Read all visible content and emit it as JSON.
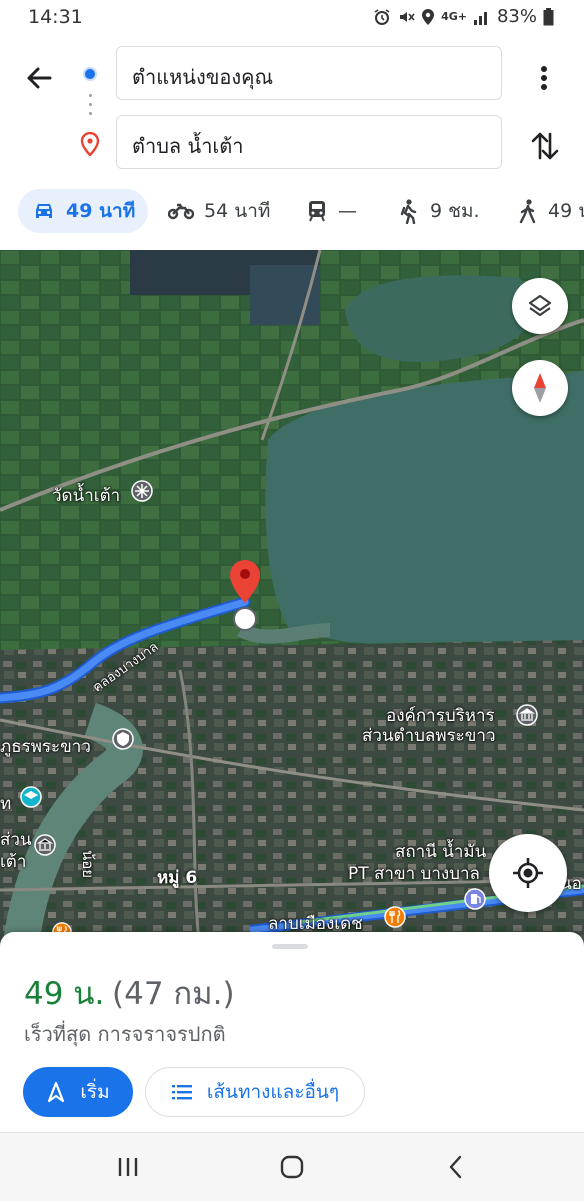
{
  "status_bar": {
    "time": "14:31",
    "network": "4G+",
    "battery": "83%"
  },
  "directions": {
    "origin_value": "ตำแหน่งของคุณ",
    "destination_value": "ตำบล น้ำเต้า"
  },
  "travel_modes": [
    {
      "name": "drive",
      "label": "49 นาที",
      "icon": "car-icon",
      "selected": true
    },
    {
      "name": "motorcycle",
      "label": "54 นาที",
      "icon": "motorcycle-icon"
    },
    {
      "name": "transit",
      "label": "—",
      "icon": "train-icon"
    },
    {
      "name": "walk",
      "label": "9 ชม.",
      "icon": "hiking-icon"
    },
    {
      "name": "hike",
      "label": "49 น",
      "icon": "walking-icon"
    }
  ],
  "map": {
    "labels": {
      "temple": "วัดน้ำเต้า",
      "canal": "คลองบางบาล",
      "canal2": "น้อย",
      "org_line1": "องค์การบริหาร",
      "org_line2": "ส่วนตำบลพระขาว",
      "left_place": "ภูธรพระขาว",
      "left_edge1": "ท",
      "left_edge2": "ส่วน",
      "left_edge3": "เต้า",
      "village": "หมู่ 6",
      "station_line1": "สถานี น้ำมัน",
      "station_line2": "PT สาขา บางบาล",
      "station_edge": "นอ",
      "restaurant": "ลาบเมืองเดช"
    },
    "colors": {
      "route": "#3a7bf0",
      "pin": "#ea4335",
      "water": "#3f6e66"
    }
  },
  "summary": {
    "duration": "49 น.",
    "distance": "(47 กม.)",
    "description": "เร็วที่สุด การจราจรปกติ",
    "start_label": "เริ่ม",
    "steps_label": "เส้นทางและอื่นๆ"
  }
}
